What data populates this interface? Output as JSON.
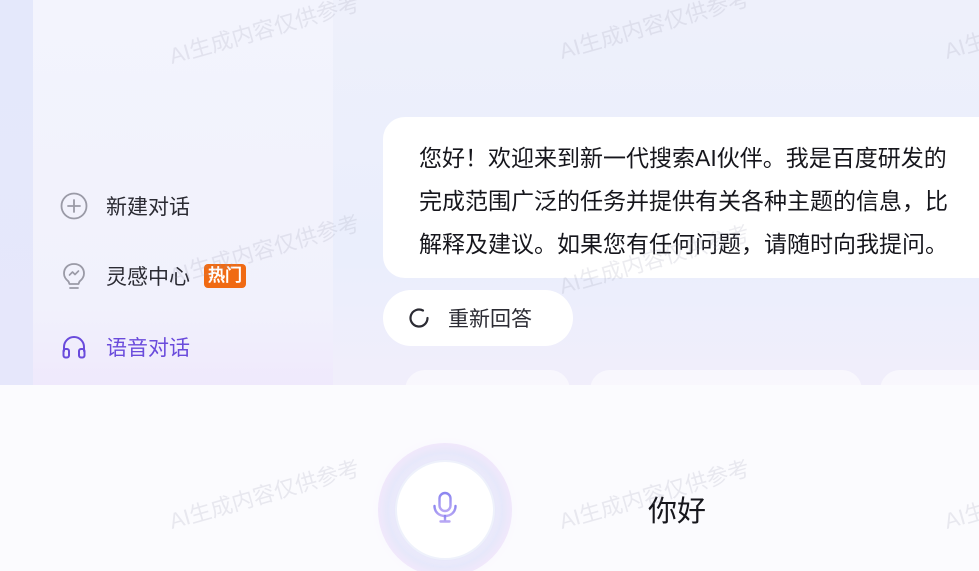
{
  "sidebar": {
    "items": [
      {
        "label": "新建对话",
        "icon": "plus-circle-icon"
      },
      {
        "label": "灵感中心",
        "icon": "lightbulb-icon",
        "badge": "热门"
      },
      {
        "label": "语音对话",
        "icon": "headphones-icon",
        "active": true
      }
    ]
  },
  "chat": {
    "assistant_message_lines": [
      "您好！欢迎来到新一代搜索AI伙伴。我是百度研发的",
      "完成范围广泛的任务并提供有关各种主题的信息，比",
      "解释及建议。如果您有任何问题，请随时向我提问。"
    ],
    "regenerate_label": "重新回答"
  },
  "voice": {
    "transcript": "你好",
    "mic_icon": "microphone-icon"
  },
  "watermark": "AI生成内容仅供参考",
  "colors": {
    "accent": "#6a4bdc",
    "badge": "#f06a13"
  }
}
